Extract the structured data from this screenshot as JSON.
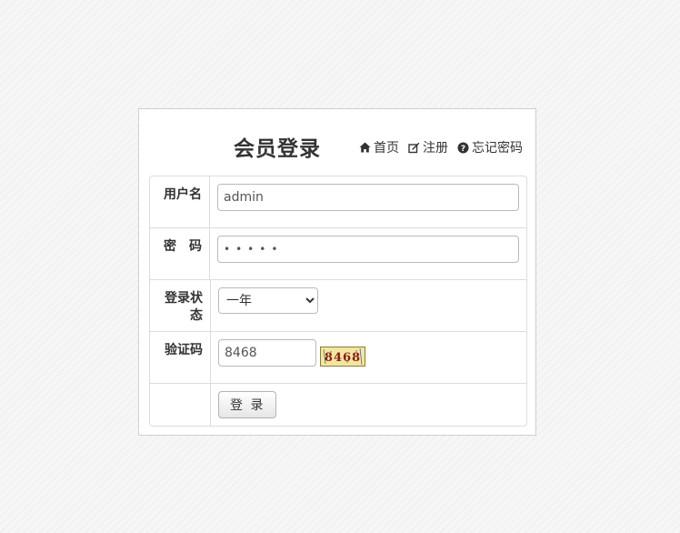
{
  "page": {
    "title": "会员登录"
  },
  "header_links": [
    {
      "label": "首页",
      "icon": "home-icon"
    },
    {
      "label": "注册",
      "icon": "edit-icon"
    },
    {
      "label": "忘记密码",
      "icon": "question-circle-icon"
    }
  ],
  "form": {
    "username": {
      "label": "用户名",
      "value": "admin"
    },
    "password": {
      "label": "密　码",
      "masked_value": "•••••"
    },
    "login_status": {
      "label": "登录状态",
      "selected": "一年",
      "options": [
        "一年"
      ]
    },
    "captcha": {
      "label": "验证码",
      "value": "8468",
      "image_text": "8468"
    },
    "submit_label": "登 录"
  },
  "colors": {
    "page_bg": "#f6f6f6",
    "panel_border": "#cfcfcf",
    "text": "#333333",
    "captcha_bg": "#f3e6a0",
    "captcha_text": "#8b1a1a"
  }
}
